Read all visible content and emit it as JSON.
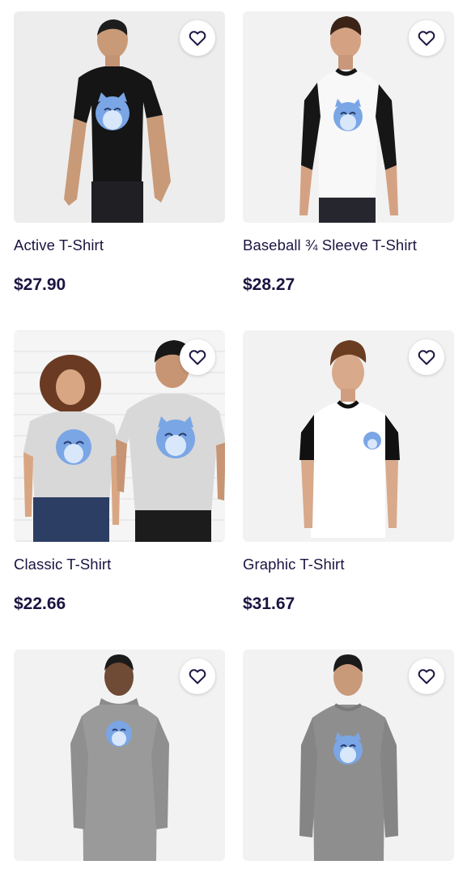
{
  "products": [
    {
      "title": "Active T-Shirt",
      "price": "$27.90"
    },
    {
      "title": "Baseball ¾ Sleeve T-Shirt",
      "price": "$28.27"
    },
    {
      "title": "Classic T-Shirt",
      "price": "$22.66"
    },
    {
      "title": "Graphic T-Shirt",
      "price": "$31.67"
    },
    {
      "title": "",
      "price": ""
    },
    {
      "title": "",
      "price": ""
    }
  ],
  "icons": {
    "favorite": "heart-outline-icon"
  },
  "colors": {
    "text": "#1b1441",
    "mascot_blue": "#7aa6e6"
  }
}
